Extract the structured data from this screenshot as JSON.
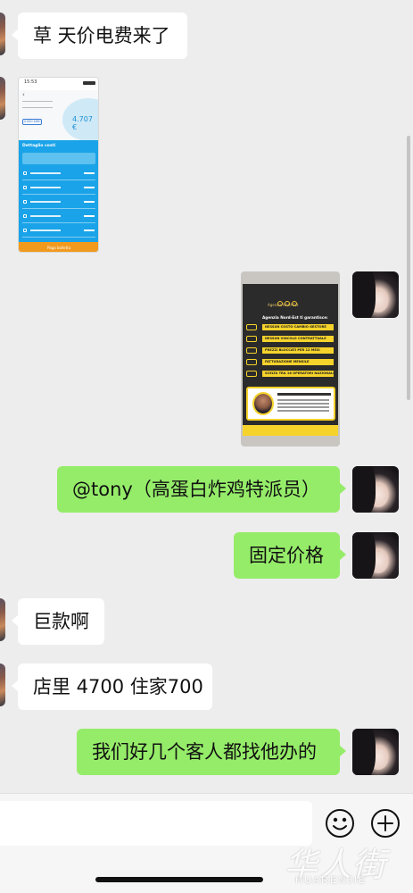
{
  "messages": [
    {
      "side": "left",
      "type": "text",
      "text": "草 天价电费来了"
    },
    {
      "side": "left",
      "type": "image",
      "image": {
        "time": "15:53",
        "pill": "4.000 kWh",
        "amount": "4.707 €",
        "section_title": "Dettaglio costi",
        "pay_button": "Paga bolletta"
      }
    },
    {
      "side": "right",
      "type": "image",
      "image": {
        "brand": "Agenzia Nord-Est",
        "headline": "Agenzia Nord-Est ti garantisce:",
        "bullets": [
          "NESSUN COSTO CAMBIO GESTORE",
          "NESSUN VINCOLO CONTRATTUALE",
          "PREZZI BLOCCATI PER 12 MESI",
          "FATTURAZIONE MENSILE",
          "SCELTA TRA 18 OPERATORI NAZIONALI"
        ]
      }
    },
    {
      "side": "right",
      "type": "text",
      "text": "@tony（高蛋白炸鸡特派员）"
    },
    {
      "side": "right",
      "type": "text",
      "text": "固定价格"
    },
    {
      "side": "left",
      "type": "text",
      "text": "巨款啊"
    },
    {
      "side": "left",
      "type": "text",
      "text": "店里 4700 住家700"
    },
    {
      "side": "right",
      "type": "text",
      "text": "我们好几个客人都找他办的"
    }
  ],
  "input": {
    "value": ""
  },
  "icons": {
    "emoji": "emoji-icon",
    "plus": "plus-icon"
  },
  "watermark": {
    "cn": "华人街",
    "en": "HUARENJIE"
  },
  "colors": {
    "background": "#ededed",
    "bubble_self": "#95ec69",
    "bubble_other": "#ffffff"
  }
}
